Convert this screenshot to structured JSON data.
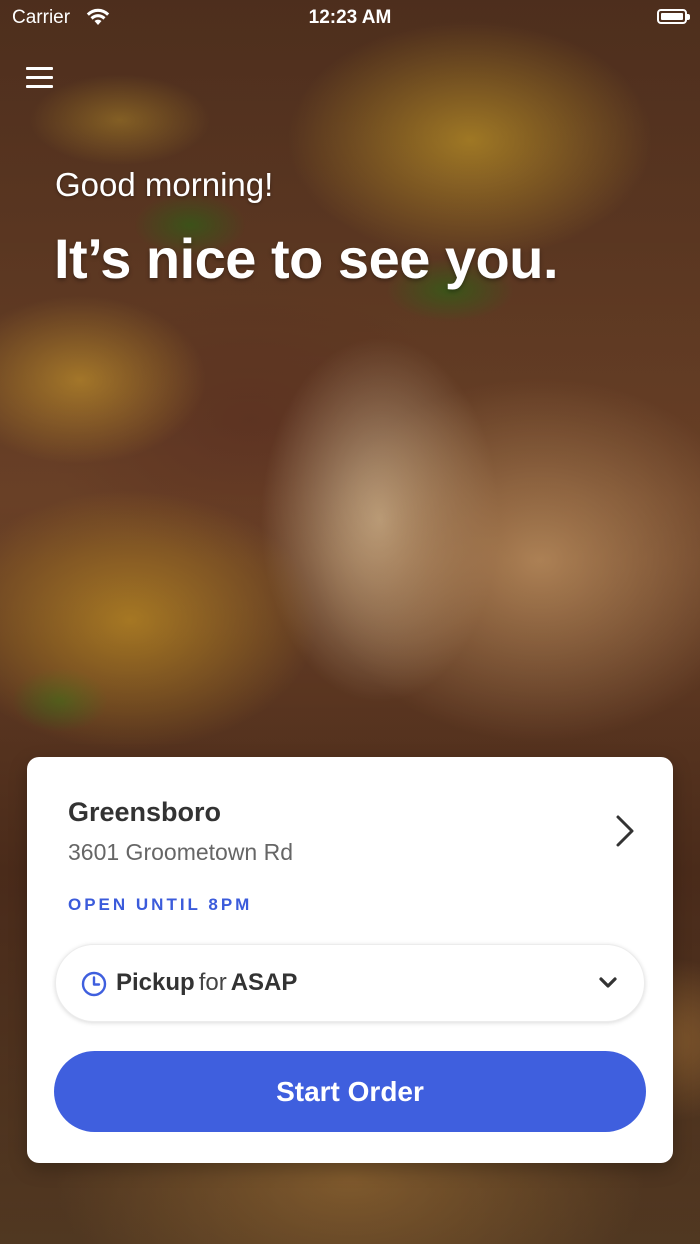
{
  "status_bar": {
    "carrier": "Carrier",
    "time": "12:23 AM"
  },
  "greeting": {
    "line1": "Good morning!",
    "line2": "It’s nice to see you."
  },
  "location": {
    "name": "Greensboro",
    "address": "3601 Groometown Rd",
    "hours": "OPEN UNTIL 8PM"
  },
  "order_mode": {
    "mode": "Pickup",
    "connector": "for",
    "time": "ASAP"
  },
  "start_button": {
    "label": "Start Order"
  },
  "colors": {
    "accent": "#3f5fde",
    "hours_text": "#3b5bdb"
  },
  "icons": [
    "wifi-icon",
    "battery-icon",
    "menu-icon",
    "chevron-right-icon",
    "clock-icon",
    "chevron-down-icon"
  ]
}
